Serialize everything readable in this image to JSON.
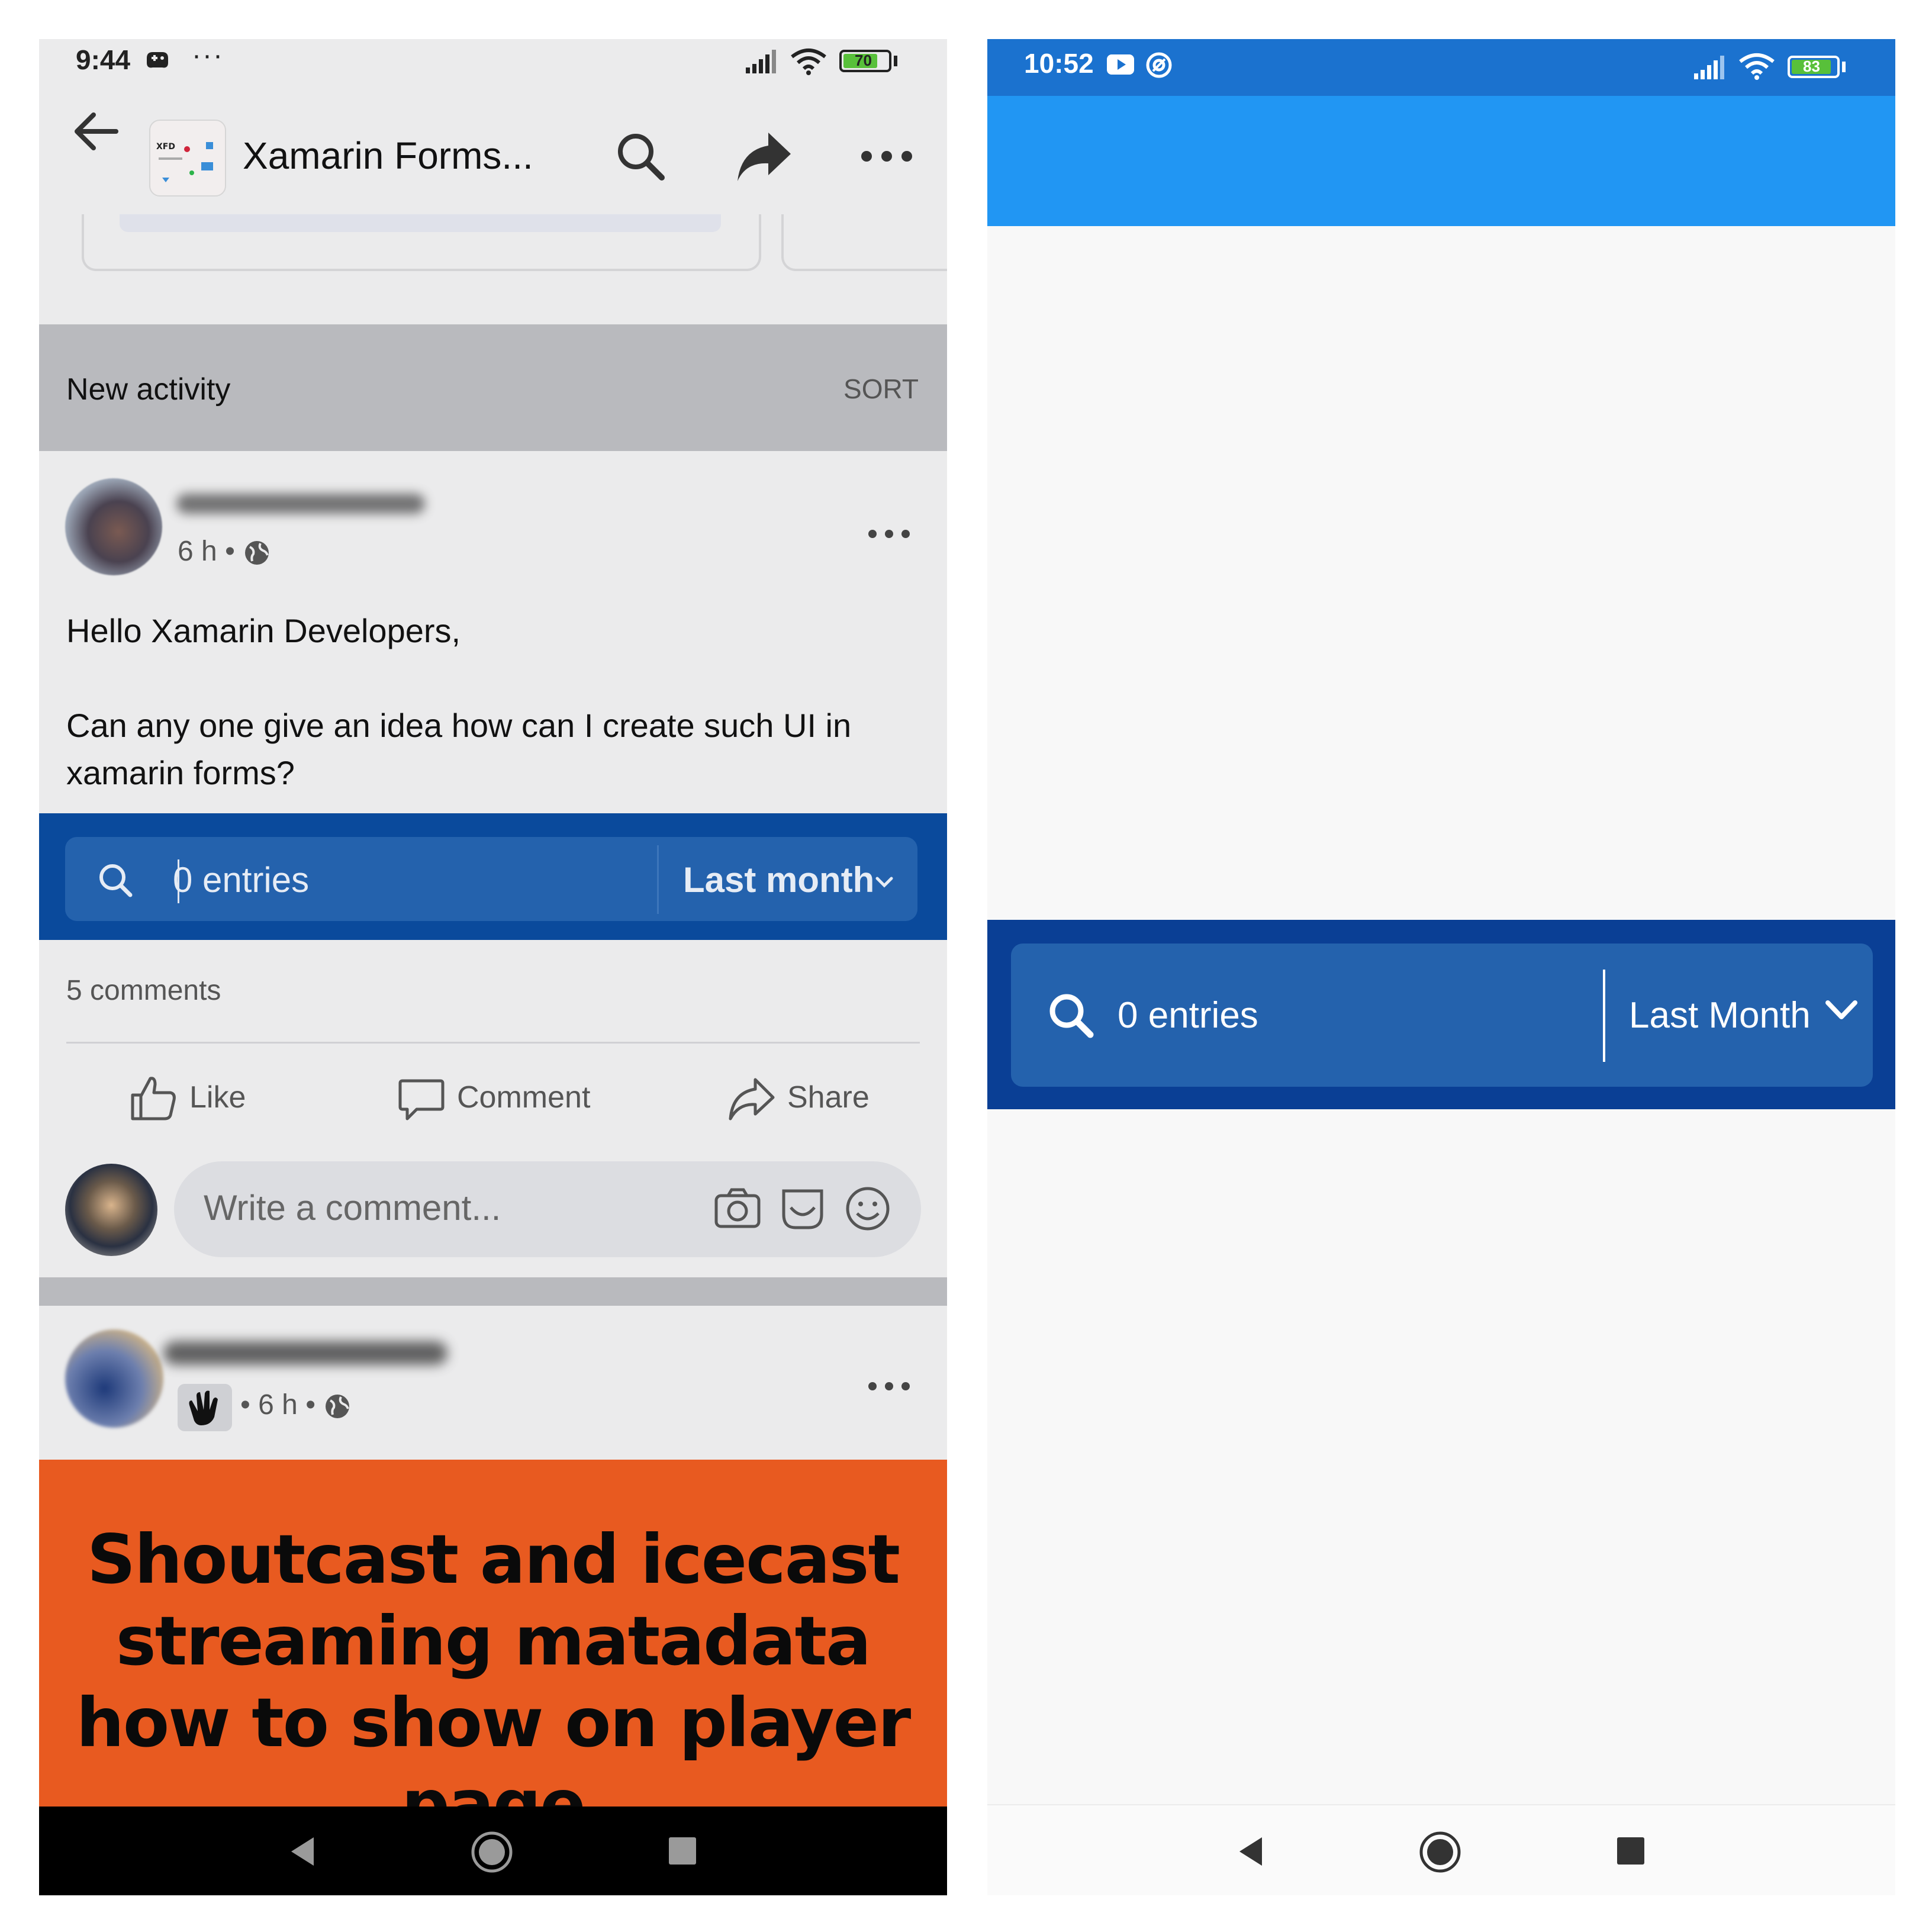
{
  "left_screen": {
    "status_bar": {
      "time": "9:44",
      "dots": "···",
      "battery": "70"
    },
    "toolbar": {
      "title": "Xamarin Forms..."
    },
    "new_activity": {
      "title": "New activity",
      "sort_label": "SORT"
    },
    "post1": {
      "time": "6 h",
      "text": "Hello Xamarin Developers,\n\nCan any one give an idea how can I create such UI in xamarin forms?",
      "embed": {
        "search_text": "0 entries",
        "period": "Last month"
      },
      "comments_count": "5 comments",
      "actions": {
        "like": "Like",
        "comment": "Comment",
        "share": "Share"
      },
      "comment_placeholder": "Write a comment..."
    },
    "post2": {
      "time": "6 h",
      "banner_text": "Shoutcast and icecast streaming matadata how to show on player page"
    }
  },
  "right_screen": {
    "status_bar": {
      "time": "10:52",
      "battery": "83"
    },
    "search_bar": {
      "search_text": "0 entries",
      "period": "Last Month"
    }
  },
  "colors": {
    "left_bg": "#ebebec",
    "embed_bar": "#0a4a9c",
    "embed_inner": "#2462ad",
    "right_status": "#1b72cf",
    "right_appbar": "#2196f3",
    "right_bar": "#0a3f95",
    "orange_banner": "#e85a20"
  },
  "icons": [
    "back-arrow-icon",
    "search-icon",
    "share-icon",
    "more-icon",
    "globe-icon",
    "like-icon",
    "comment-icon",
    "camera-icon",
    "sticker-icon",
    "emoji-icon",
    "wave-icon",
    "chevron-down-icon",
    "nav-back-icon",
    "nav-home-icon",
    "nav-recents-icon"
  ]
}
